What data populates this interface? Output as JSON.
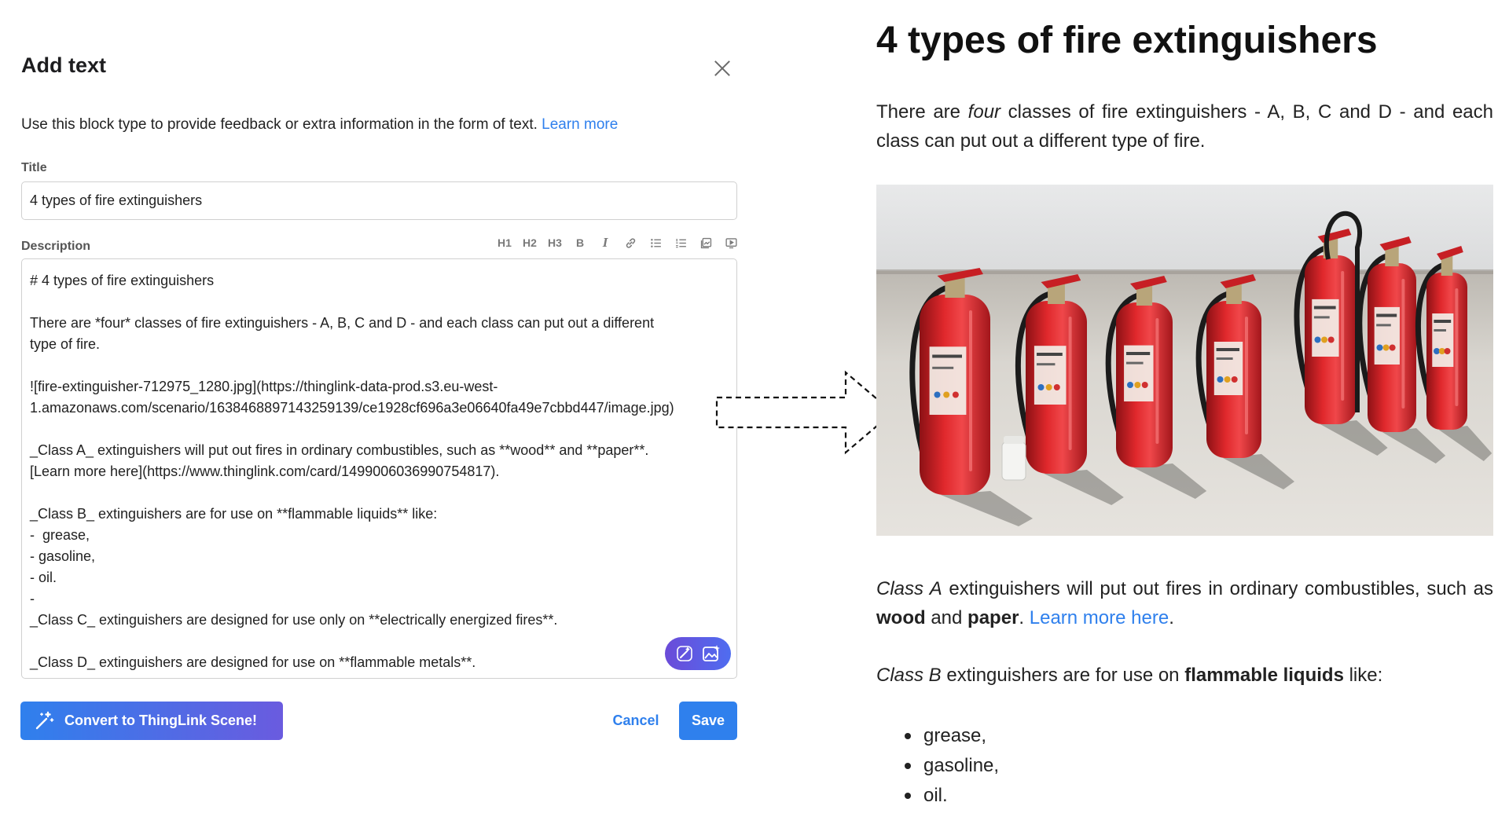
{
  "modal": {
    "title": "Add text",
    "intro": "Use this block type to provide feedback or extra information in the form of text. ",
    "intro_link": "Learn more",
    "title_label": "Title",
    "title_value": "4 types of fire extinguishers",
    "description_label": "Description",
    "toolbar": {
      "h1": "H1",
      "h2": "H2",
      "h3": "H3",
      "bold": "B",
      "italic": "I"
    },
    "description_lines": [
      "# 4 types of fire extinguishers",
      "",
      "There are *four* classes of fire extinguishers - A, B, C and D - and each class can put out a different",
      "type of fire.",
      "",
      "![fire-extinguisher-712975_1280.jpg](https://thinglink-data-prod.s3.eu-west-",
      "1.amazonaws.com/scenario/1638468897143259139/ce1928cf696a3e06640fa49e7cbbd447/image.jpg)",
      "",
      "_Class A_ extinguishers will put out fires in ordinary combustibles, such as **wood** and **paper**.",
      "[Learn more here](https://www.thinglink.com/card/1499006036990754817).",
      "",
      "_Class B_ extinguishers are for use on **flammable liquids** like:",
      "-  grease,",
      "- gasoline,",
      "- oil.",
      "-",
      "_Class C_ extinguishers are designed for use only on **electrically energized fires**.",
      "",
      "_Class D_ extinguishers are designed for use on **flammable metals**."
    ],
    "convert_label": "Convert to ThingLink Scene!",
    "cancel_label": "Cancel",
    "save_label": "Save"
  },
  "preview": {
    "heading": "4 types of fire extinguishers",
    "p1_before": "There are ",
    "p1_em": "four",
    "p1_after": " classes of fire extinguishers - A, B, C and D - and each class can put out a different type of fire.",
    "p2_em": "Class A",
    "p2_text1": " extinguishers will put out fires in ordinary combustibles, such as ",
    "p2_bold1": "wood",
    "p2_text2": " and ",
    "p2_bold2": "paper",
    "p2_text3": ". ",
    "p2_link": "Learn more here",
    "p2_end": ".",
    "p3_em": "Class B",
    "p3_text1": " extinguishers are for use on ",
    "p3_bold": "flammable liquids",
    "p3_text2": " like:",
    "list": [
      "grease,",
      "gasoline,",
      "oil."
    ]
  },
  "colors": {
    "accent": "#2f80ed",
    "extinguisher_red": "#d8262c",
    "gradient_purple": "#6a5bdf"
  },
  "icons": [
    "close-icon",
    "link-icon",
    "bullet-list-icon",
    "numbered-list-icon",
    "image-icon",
    "video-icon",
    "magic-wand-icon",
    "ai-image-icon",
    "dashed-arrow"
  ]
}
